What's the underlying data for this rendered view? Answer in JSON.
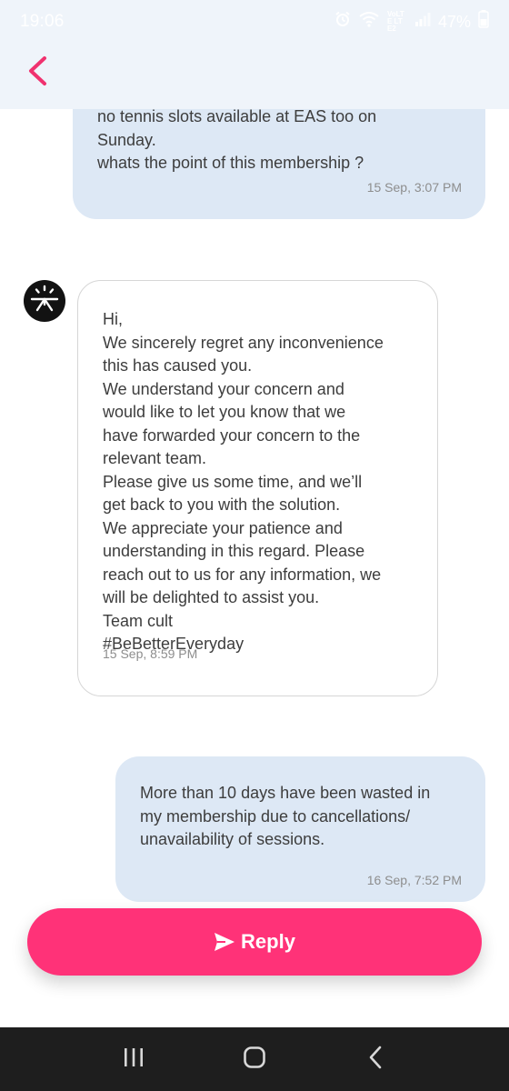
{
  "status_bar": {
    "time": "19:06",
    "network": "VoLTE LTE2",
    "battery": "47%",
    "icons": [
      "alarm-icon",
      "wifi-icon",
      "signal-icon",
      "battery-icon"
    ]
  },
  "header": {
    "back_icon": "chevron-left-icon",
    "accent_color": "#f0326f"
  },
  "messages": [
    {
      "sender": "user",
      "lines": [
        "no tennis slots available at EAS too on",
        "Sunday.",
        "whats the point of this membership ?"
      ],
      "time": "15 Sep, 3:07 PM"
    },
    {
      "sender": "support",
      "avatar_icon": "cult-logo-icon",
      "lines": [
        "Hi,",
        "We sincerely regret any inconvenience",
        "this has caused you.",
        "We understand your concern and",
        "would like to let you know that we",
        "have forwarded your concern to the",
        "relevant team.",
        "Please give us some time, and we’ll",
        "get back to you with the solution.",
        "We appreciate your patience and",
        "understanding in this regard. Please",
        "reach out to us for any information, we",
        "will be delighted to assist you.",
        "Team cult",
        "#BeBetterEveryday"
      ],
      "time": "15 Sep, 8:59 PM"
    },
    {
      "sender": "user",
      "lines": [
        "More than 10 days have been wasted in",
        "my membership due to cancellations/",
        "unavailability of sessions."
      ],
      "time": "16 Sep, 7:52 PM"
    }
  ],
  "reply_button": {
    "label": "Reply",
    "icon": "send-icon",
    "color": "#ff3278"
  },
  "nav_bar": {
    "buttons": [
      "recent-apps-icon",
      "home-icon",
      "back-icon"
    ]
  }
}
